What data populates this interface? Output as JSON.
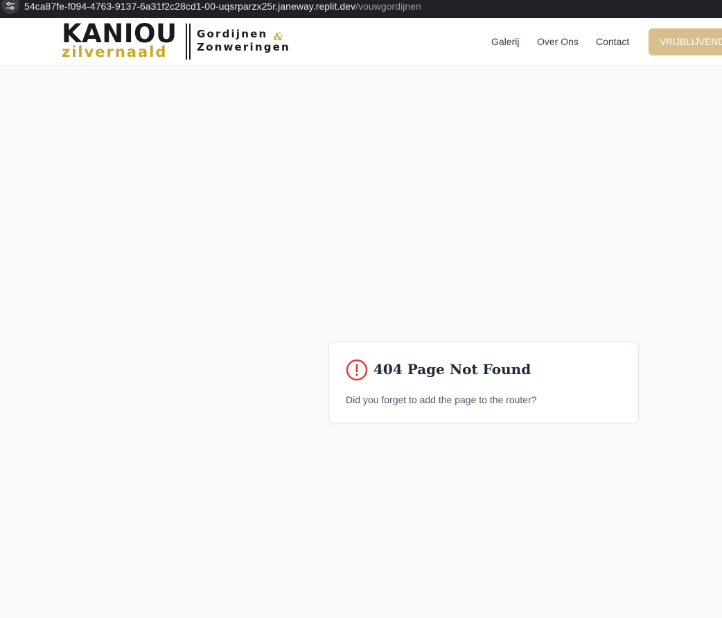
{
  "browser": {
    "url_host": "54ca87fe-f094-4763-9137-6a31f2c28cd1-00-uqsrparzx25r.janeway.replit.dev",
    "url_path": "/vouwgordijnen",
    "site_info_icon": "tune-icon"
  },
  "header": {
    "logo": {
      "main": "KANIOU",
      "sub": "zilvernaald",
      "line1": "Gordijnen",
      "amp": "&",
      "line2": "Zonweringen",
      "brand_color": "#c7a92a"
    },
    "nav": {
      "galerij": "Galerij",
      "over_ons": "Over Ons",
      "contact": "Contact"
    },
    "cta_label": "VRIJBLIJVEND",
    "cta_color": "#d8be8a"
  },
  "error_card": {
    "icon": "alert-circle-icon",
    "icon_color": "#dc3d32",
    "title": "404 Page Not Found",
    "message": "Did you forget to add the page to the router?"
  }
}
